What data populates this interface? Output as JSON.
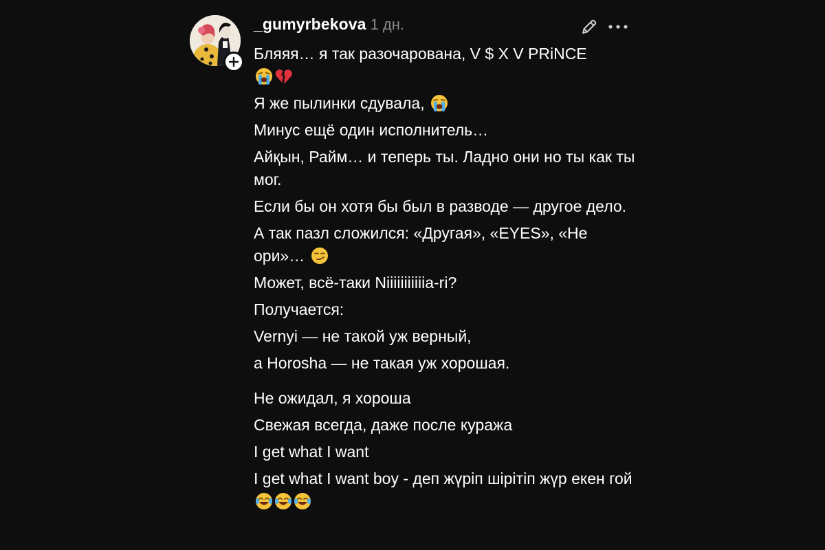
{
  "post": {
    "username": "_gumyrbekova",
    "timestamp": "1 дн.",
    "icons": {
      "avatar": "avatar-illustration",
      "follow": "plus-icon",
      "edit": "pencil-icon",
      "more": "ellipsis-icon"
    },
    "lines": [
      {
        "text": "Бляяя… я так разочарована, V $ X V PRiNCE",
        "emoji_after": []
      },
      {
        "text": "",
        "emoji_after": [
          "loudly-crying-face",
          "broken-heart"
        ]
      },
      {
        "text": "Я же пылинки сдувала,",
        "emoji_after": [
          "loudly-crying-face"
        ]
      },
      {
        "text": "Минус ещё один исполнитель…",
        "emoji_after": []
      },
      {
        "text": "Айқын, Райм… и теперь ты. Ладно они но ты как ты мог.",
        "emoji_after": []
      },
      {
        "text": "Если бы он хотя бы был в разводе — другое дело.",
        "emoji_after": []
      },
      {
        "text": "А так пазл сложился: «Другая», «EYES», «Не ори»…",
        "emoji_after": [
          "smirking-face"
        ]
      },
      {
        "text": "Может, всё-таки Niiiiiiiiiiia-ri?",
        "emoji_after": []
      },
      {
        "text": "Получается:",
        "emoji_after": []
      },
      {
        "text": "Vernyi — не такой уж верный,",
        "emoji_after": []
      },
      {
        "text": "а Horosha — не такая уж хорошая.",
        "emoji_after": []
      },
      {
        "text": "Не ожидал, я хороша",
        "emoji_after": []
      },
      {
        "text": "Свежая всегда, даже после куража",
        "emoji_after": []
      },
      {
        "text": "I get what I want",
        "emoji_after": []
      },
      {
        "text": "I get what I want boy - деп жүріп шірітіп жүр екен гой",
        "emoji_after": [
          "face-with-tears-of-joy",
          "face-with-tears-of-joy",
          "face-with-tears-of-joy"
        ]
      }
    ]
  },
  "colors": {
    "background": "#0e0e0e",
    "text": "#ffffff",
    "muted": "#8a8a8a"
  }
}
